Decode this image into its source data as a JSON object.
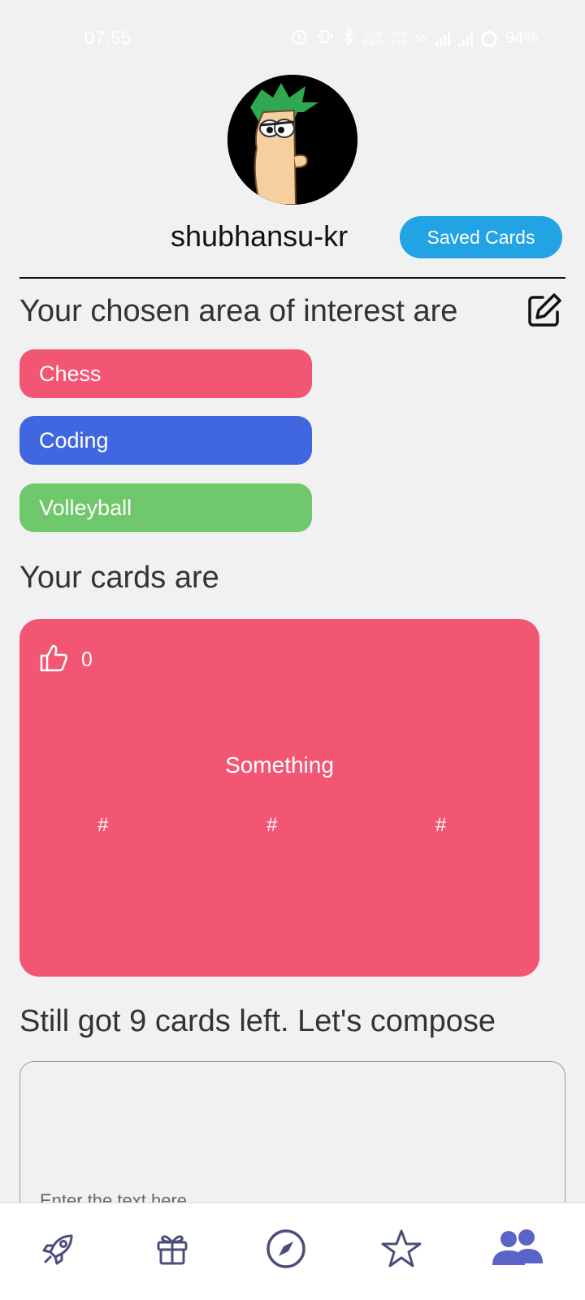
{
  "status_bar": {
    "time": "07:55",
    "net_speed_value": "5.00",
    "net_speed_unit": "KB/S",
    "net_type_top": "Vo8",
    "net_type_bottom": "LTE",
    "net_5g": "5G",
    "battery": "94%"
  },
  "profile": {
    "username": "shubhansu-kr",
    "saved_cards_label": "Saved Cards"
  },
  "interests": {
    "title": "Your chosen area of interest are",
    "items": [
      {
        "label": "Chess",
        "color": "#f25673"
      },
      {
        "label": "Coding",
        "color": "#4167e0"
      },
      {
        "label": "Volleyball",
        "color": "#6fc86b"
      }
    ]
  },
  "cards": {
    "title": "Your cards are",
    "items": [
      {
        "likes": "0",
        "text": "Something",
        "tags": [
          "#",
          "#",
          "#"
        ],
        "color": "#f25673"
      }
    ]
  },
  "compose": {
    "title": "Still got 9 cards left. Let's compose",
    "placeholder": "Enter the text here"
  },
  "bottom_nav": {
    "items": [
      "rocket-icon",
      "gift-icon",
      "compass-icon",
      "star-icon",
      "people-icon"
    ],
    "accent": "#5a64c8",
    "icon_color": "#4a4f7a"
  }
}
